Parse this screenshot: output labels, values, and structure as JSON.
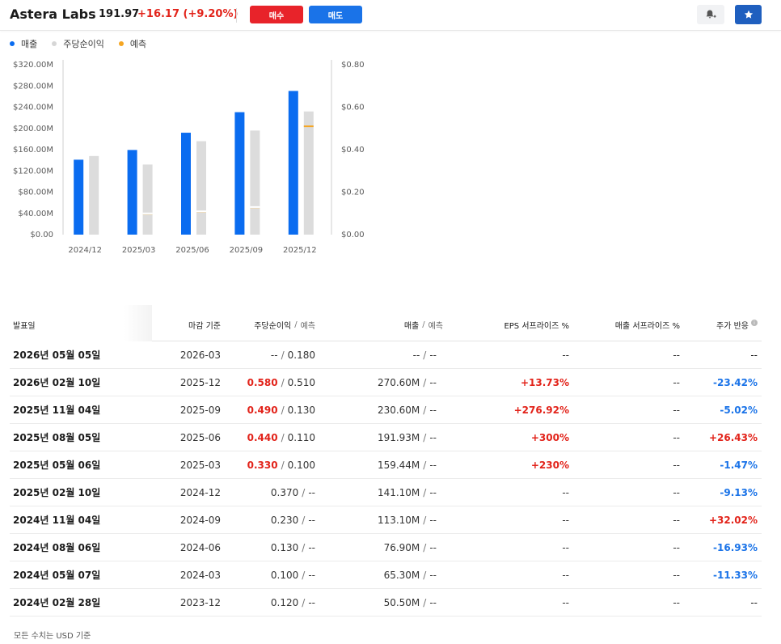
{
  "header": {
    "name": "Astera Labs",
    "price": "191.97",
    "change": "+16.17 (+9.20%)",
    "buy_label": "매수",
    "sell_label": "매도",
    "alert_icon": "bell-plus-icon",
    "star_icon": "star-icon"
  },
  "legend": {
    "revenue": "매출",
    "eps": "주당순이익",
    "forecast": "예측"
  },
  "colors": {
    "revenue": "#0a6cf0",
    "eps": "#dcdcdc",
    "forecast": "#f5a623",
    "up": "#e2231a",
    "down": "#1a73e8"
  },
  "chart_data": {
    "type": "bar",
    "categories": [
      "2024/12",
      "2025/03",
      "2025/06",
      "2025/09",
      "2025/12"
    ],
    "series": [
      {
        "name": "매출",
        "axis": "left",
        "values": [
          141.1,
          159.44,
          191.93,
          230.6,
          270.6
        ]
      },
      {
        "name": "주당순이익",
        "axis": "right",
        "values": [
          0.37,
          0.33,
          0.44,
          0.49,
          0.58
        ]
      },
      {
        "name": "예측",
        "axis": "right",
        "values": [
          null,
          0.1,
          0.11,
          0.13,
          0.51
        ]
      }
    ],
    "left_ticks": [
      "$0.00",
      "$40.00M",
      "$80.00M",
      "$120.00M",
      "$160.00M",
      "$200.00M",
      "$240.00M",
      "$280.00M",
      "$320.00M"
    ],
    "right_ticks": [
      "$0.00",
      "$0.20",
      "$0.40",
      "$0.60",
      "$0.80"
    ],
    "ylim_left": [
      0,
      320
    ],
    "ylim_right": [
      0,
      0.8
    ],
    "grid": false
  },
  "table": {
    "headers": {
      "date": "발표일",
      "period": "마감 기준",
      "eps": "주당순이익",
      "eps_sep": "/",
      "eps_forecast": "예측",
      "revenue": "매출",
      "rev_sep": "/",
      "rev_forecast": "예측",
      "eps_surprise": "EPS 서프라이즈 %",
      "rev_surprise": "매출 서프라이즈 %",
      "reaction": "주가 반응"
    },
    "rows": [
      {
        "date": "2026년 05월 05일",
        "period": "2026-03",
        "eps": "--",
        "eps_est": "0.180",
        "rev": "--",
        "rev_est": "--",
        "eps_surprise": "--",
        "rev_surprise": "--",
        "reaction": "--",
        "eps_dir": "flat",
        "eps_surprise_dir": "flat",
        "reaction_dir": "flat"
      },
      {
        "date": "2026년 02월 10일",
        "period": "2025-12",
        "eps": "0.580",
        "eps_est": "0.510",
        "rev": "270.60M",
        "rev_est": "--",
        "eps_surprise": "+13.73%",
        "rev_surprise": "--",
        "reaction": "-23.42%",
        "eps_dir": "up",
        "eps_surprise_dir": "up",
        "reaction_dir": "down"
      },
      {
        "date": "2025년 11월 04일",
        "period": "2025-09",
        "eps": "0.490",
        "eps_est": "0.130",
        "rev": "230.60M",
        "rev_est": "--",
        "eps_surprise": "+276.92%",
        "rev_surprise": "--",
        "reaction": "-5.02%",
        "eps_dir": "up",
        "eps_surprise_dir": "up",
        "reaction_dir": "down"
      },
      {
        "date": "2025년 08월 05일",
        "period": "2025-06",
        "eps": "0.440",
        "eps_est": "0.110",
        "rev": "191.93M",
        "rev_est": "--",
        "eps_surprise": "+300%",
        "rev_surprise": "--",
        "reaction": "+26.43%",
        "eps_dir": "up",
        "eps_surprise_dir": "up",
        "reaction_dir": "up"
      },
      {
        "date": "2025년 05월 06일",
        "period": "2025-03",
        "eps": "0.330",
        "eps_est": "0.100",
        "rev": "159.44M",
        "rev_est": "--",
        "eps_surprise": "+230%",
        "rev_surprise": "--",
        "reaction": "-1.47%",
        "eps_dir": "up",
        "eps_surprise_dir": "up",
        "reaction_dir": "down"
      },
      {
        "date": "2025년 02월 10일",
        "period": "2024-12",
        "eps": "0.370",
        "eps_est": "--",
        "rev": "141.10M",
        "rev_est": "--",
        "eps_surprise": "--",
        "rev_surprise": "--",
        "reaction": "-9.13%",
        "eps_dir": "flat",
        "eps_surprise_dir": "flat",
        "reaction_dir": "down"
      },
      {
        "date": "2024년 11월 04일",
        "period": "2024-09",
        "eps": "0.230",
        "eps_est": "--",
        "rev": "113.10M",
        "rev_est": "--",
        "eps_surprise": "--",
        "rev_surprise": "--",
        "reaction": "+32.02%",
        "eps_dir": "flat",
        "eps_surprise_dir": "flat",
        "reaction_dir": "up"
      },
      {
        "date": "2024년 08월 06일",
        "period": "2024-06",
        "eps": "0.130",
        "eps_est": "--",
        "rev": "76.90M",
        "rev_est": "--",
        "eps_surprise": "--",
        "rev_surprise": "--",
        "reaction": "-16.93%",
        "eps_dir": "flat",
        "eps_surprise_dir": "flat",
        "reaction_dir": "down"
      },
      {
        "date": "2024년 05월 07일",
        "period": "2024-03",
        "eps": "0.100",
        "eps_est": "--",
        "rev": "65.30M",
        "rev_est": "--",
        "eps_surprise": "--",
        "rev_surprise": "--",
        "reaction": "-11.33%",
        "eps_dir": "flat",
        "eps_surprise_dir": "flat",
        "reaction_dir": "down"
      },
      {
        "date": "2024년 02월 28일",
        "period": "2023-12",
        "eps": "0.120",
        "eps_est": "--",
        "rev": "50.50M",
        "rev_est": "--",
        "eps_surprise": "--",
        "rev_surprise": "--",
        "reaction": "--",
        "eps_dir": "flat",
        "eps_surprise_dir": "flat",
        "reaction_dir": "flat"
      }
    ]
  },
  "footnote": "모든 수치는 USD 기준"
}
